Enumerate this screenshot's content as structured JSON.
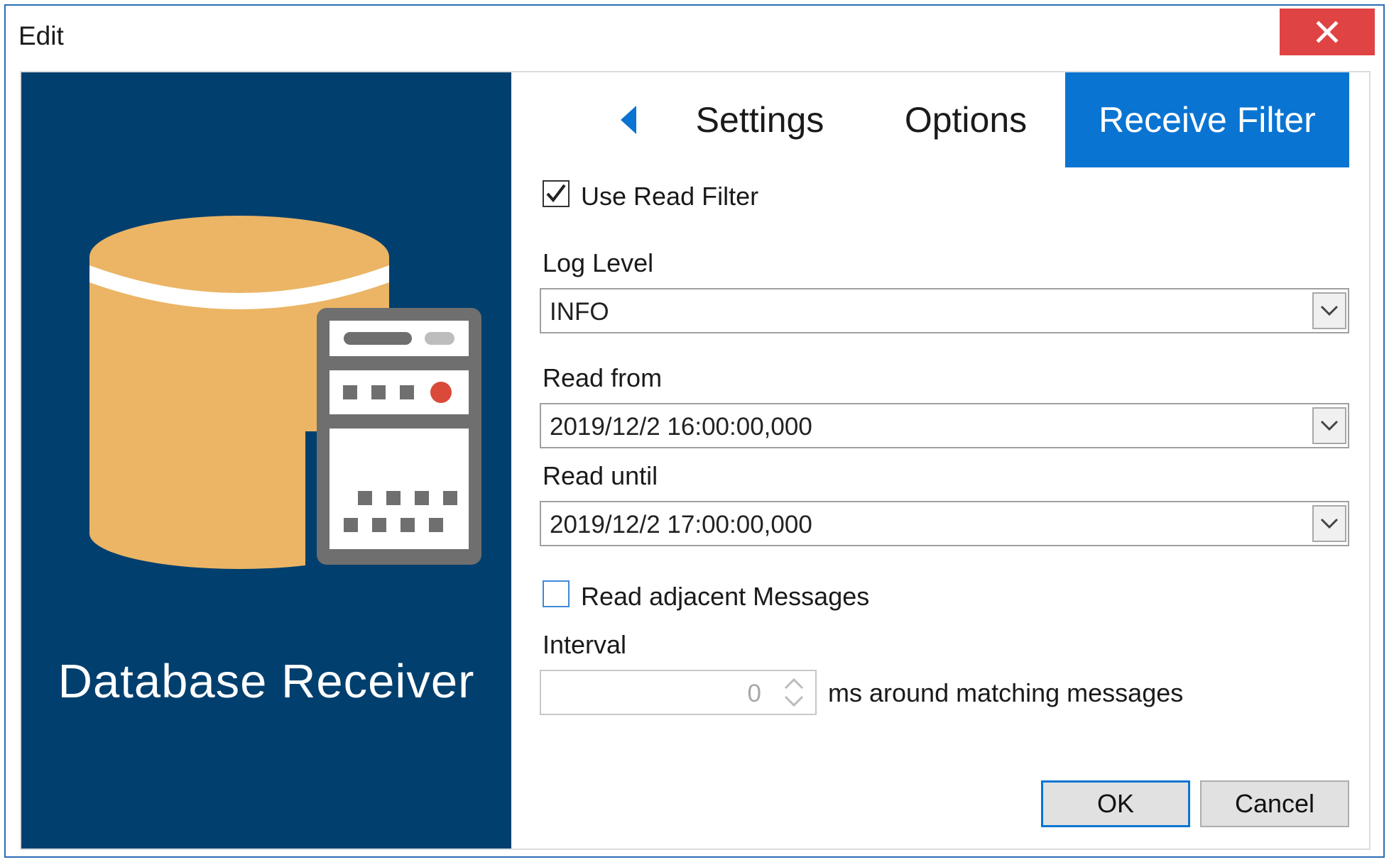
{
  "window": {
    "title": "Edit"
  },
  "left_panel": {
    "title": "Database Receiver",
    "colors": {
      "background": "#003f6e",
      "cylinder": "#ebb565",
      "server": "#6f6f6f",
      "led": "#d94a3a"
    }
  },
  "tabs": {
    "items": [
      {
        "label": "Settings",
        "active": false
      },
      {
        "label": "Options",
        "active": false
      },
      {
        "label": "Receive Filter",
        "active": true
      }
    ],
    "active_color": "#0a74d2"
  },
  "form": {
    "use_read_filter": {
      "label": "Use Read Filter",
      "checked": true
    },
    "log_level": {
      "label": "Log Level",
      "value": "INFO"
    },
    "read_from": {
      "label": "Read from",
      "value": "2019/12/2 16:00:00,000"
    },
    "read_until": {
      "label": "Read until",
      "value": "2019/12/2 17:00:00,000"
    },
    "read_adjacent": {
      "label": "Read adjacent Messages",
      "checked": false
    },
    "interval": {
      "label": "Interval",
      "value": "0",
      "suffix": "ms around matching messages"
    }
  },
  "buttons": {
    "ok": "OK",
    "cancel": "Cancel"
  }
}
